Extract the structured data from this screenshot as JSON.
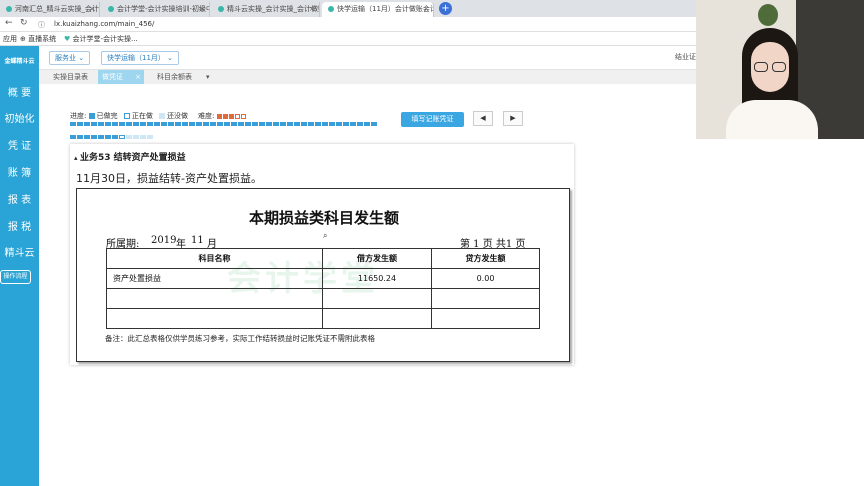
{
  "browser": {
    "tabs": [
      {
        "label": "河南汇总_精斗云实操_会计实战...",
        "active": false
      },
      {
        "label": "会计学堂-会计实操培训-初级中级...",
        "active": false
      },
      {
        "label": "精斗云实操_会计实操_会计做账...",
        "active": false
      },
      {
        "label": "快学运输（11月）会计做账会计...",
        "active": true
      }
    ],
    "new_tab": "+",
    "url": "lx.kuaizhang.com/main_456/",
    "bookmarks": [
      "应用",
      "直播系统",
      "会计学堂-会计实操..."
    ]
  },
  "sidebar": {
    "brand": "金蝶精斗云",
    "items": [
      "概 要",
      "初始化",
      "凭 证",
      "账 簿",
      "报 表",
      "报 税",
      "精斗云"
    ],
    "flow_button": "操作流程"
  },
  "menu": {
    "service": "服务业",
    "company": "快学运输（11月）",
    "corner_text": "结业证"
  },
  "subtabs": [
    {
      "label": "实操目录表",
      "active": false
    },
    {
      "label": "做凭证",
      "active": true
    },
    {
      "label": "科目余额表",
      "active": false
    }
  ],
  "progress": {
    "label": "进度:",
    "legend_done": "已做完",
    "legend_doing": "正在做",
    "legend_todo": "还没做",
    "difficulty_label": "难度:",
    "difficulty_level": 3,
    "difficulty_max": 5,
    "done_count": 52,
    "current_index": 52,
    "total": 56
  },
  "actions": {
    "fill_voucher": "填写记账凭证",
    "prev": "◀",
    "next": "▶"
  },
  "business": {
    "title": "业务53 结转资产处置损益",
    "description": "11月30日，损益结转-资产处置损益。"
  },
  "report": {
    "title": "本期损益类科目发生额",
    "period_label": "所属期:",
    "year": "2019",
    "year_unit": "年",
    "month": "11",
    "month_unit": "月",
    "page_text": "第 1 页 共1 页",
    "watermark": "会计学堂",
    "headers": [
      "科目名称",
      "借方发生额",
      "贷方发生额"
    ],
    "rows": [
      [
        "资产处置损益",
        "11650.24",
        "0.00"
      ],
      [
        "",
        "",
        ""
      ],
      [
        "",
        "",
        ""
      ]
    ],
    "note": "备注：此汇总表格仅供学员练习参考，实际工作结转损益时记账凭证不需附此表格"
  },
  "colors": {
    "sidebar": "#2aa4d6",
    "accent": "#3aa6e2",
    "active_subtab": "#9ed5ef"
  }
}
